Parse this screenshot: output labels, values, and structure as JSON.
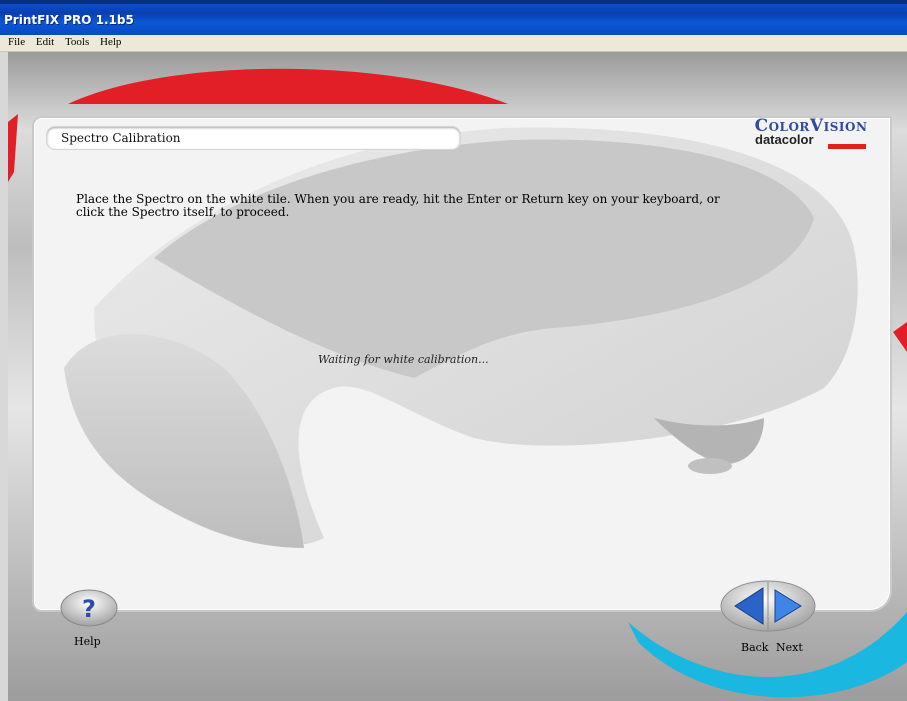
{
  "window": {
    "title": "PrintFIX PRO 1.1b5"
  },
  "menu": {
    "items": [
      "File",
      "Edit",
      "Tools",
      "Help"
    ]
  },
  "brand": {
    "top": "ColorVision",
    "bottom": "datacolor",
    "accent": "#e02020",
    "blue": "#2f4aa0"
  },
  "panel": {
    "header": "Spectro Calibration",
    "instruction": "Place the Spectro on the white tile. When you are ready, hit the Enter or Return key on your keyboard, or click the Spectro itself, to proceed.",
    "status": "Waiting for white calibration..."
  },
  "footer": {
    "help_icon": "question-icon",
    "help_label": "Help",
    "back_label": "Back",
    "next_label": "Next",
    "back_icon": "arrow-left-icon",
    "next_icon": "arrow-right-icon"
  }
}
